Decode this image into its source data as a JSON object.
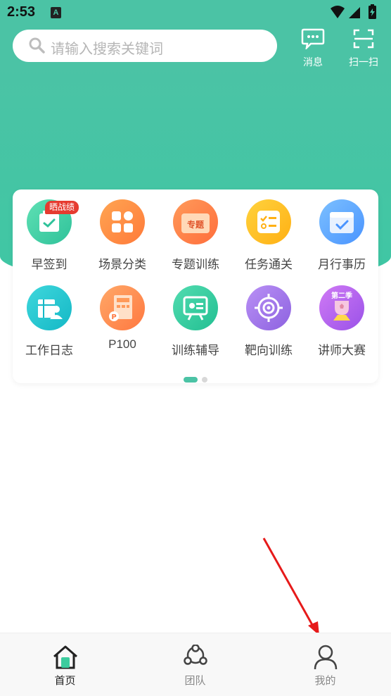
{
  "status_bar": {
    "time": "2:53",
    "notification_icon": "A"
  },
  "search": {
    "placeholder": "请输入搜索关键词"
  },
  "header_actions": [
    {
      "label": "消息",
      "icon": "message-icon"
    },
    {
      "label": "扫一扫",
      "icon": "scan-icon"
    }
  ],
  "grid": {
    "badge": "晒战绩",
    "items": [
      {
        "label": "早签到",
        "icon": "calendar-check-icon",
        "color": "#3ccc9e"
      },
      {
        "label": "场景分类",
        "icon": "grid-icon",
        "color": "#ff8a3d"
      },
      {
        "label": "专题训练",
        "icon": "topic-icon",
        "color": "#ff7a45",
        "icon_text": "专题"
      },
      {
        "label": "任务通关",
        "icon": "checklist-icon",
        "color": "#ffc020"
      },
      {
        "label": "月行事历",
        "icon": "monthly-calendar-icon",
        "color": "#5aa8ff"
      },
      {
        "label": "工作日志",
        "icon": "work-log-icon",
        "color": "#1fc4d0"
      },
      {
        "label": "P100",
        "icon": "p100-icon",
        "color": "#ff8f40"
      },
      {
        "label": "训练辅导",
        "icon": "presentation-icon",
        "color": "#34cc9c"
      },
      {
        "label": "靶向训练",
        "icon": "target-icon",
        "color": "#a37ae8"
      },
      {
        "label": "讲师大赛",
        "icon": "trophy-icon",
        "color": "#b06ef0",
        "icon_text": "第二季"
      }
    ]
  },
  "tabs": [
    {
      "label": "首页",
      "icon": "home-icon",
      "active": true
    },
    {
      "label": "团队",
      "icon": "team-icon",
      "active": false
    },
    {
      "label": "我的",
      "icon": "profile-icon",
      "active": false
    }
  ]
}
